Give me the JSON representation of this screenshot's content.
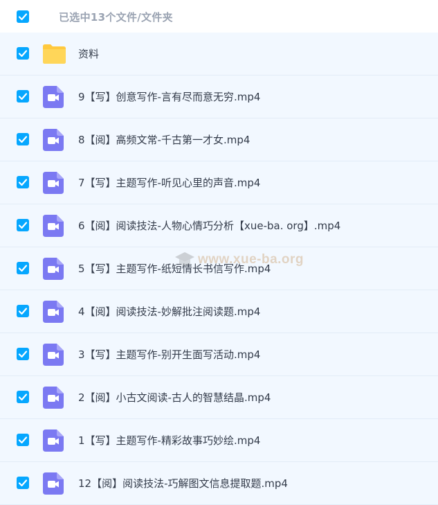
{
  "header": {
    "selection_text": "已选中13个文件/文件夹"
  },
  "colors": {
    "checkbox": "#06a7ff",
    "row_bg": "#f2f8ff",
    "video_icon": "#7b79f2",
    "folder": "#ffd659"
  },
  "items": [
    {
      "name": "资料",
      "icon": "folder-icon"
    },
    {
      "name": "9【写】创意写作-言有尽而意无穷.mp4",
      "icon": "video-file-icon"
    },
    {
      "name": "8【阅】高频文常-千古第一才女.mp4",
      "icon": "video-file-icon"
    },
    {
      "name": "7【写】主题写作-听见心里的声音.mp4",
      "icon": "video-file-icon"
    },
    {
      "name": "6【阅】阅读技法-人物心情巧分析【xue-ba. org】.mp4",
      "icon": "video-file-icon"
    },
    {
      "name": "5【写】主题写作-纸短情长书信写作.mp4",
      "icon": "video-file-icon"
    },
    {
      "name": "4【阅】阅读技法-妙解批注阅读题.mp4",
      "icon": "video-file-icon"
    },
    {
      "name": "3【写】主题写作-别开生面写活动.mp4",
      "icon": "video-file-icon"
    },
    {
      "name": "2【阅】小古文阅读-古人的智慧结晶.mp4",
      "icon": "video-file-icon"
    },
    {
      "name": "1【写】主题写作-精彩故事巧妙绘.mp4",
      "icon": "video-file-icon"
    },
    {
      "name": "12【阅】阅读技法-巧解图文信息提取题.mp4",
      "icon": "video-file-icon"
    }
  ],
  "watermark": {
    "text": "www.xue-ba.org"
  }
}
